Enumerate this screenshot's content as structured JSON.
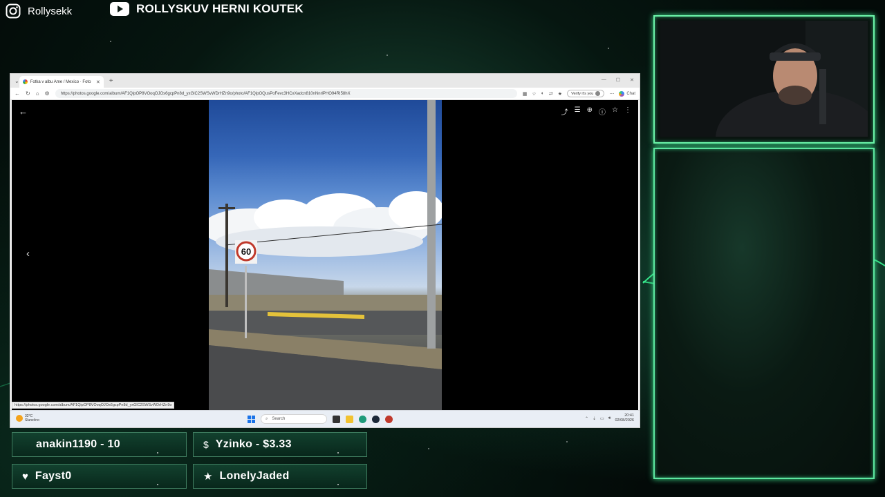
{
  "social": {
    "instagram_handle": "Rollysekk",
    "youtube_channel": "ROLLYSKUV HERNI KOUTEK"
  },
  "browser": {
    "tab_title": "Fotka v albu Ame / Mexico · Foto",
    "new_tab": "+",
    "url": "https://photos.google.com/album/AF1QipOP8VOoqOJOs6gcpPn8d_yxGlC2SWSvWDrHZn9o/photo/AF1QipOQusPoFevc3HCxXadcn810nNnrlPHO94RI58hX",
    "verify_label": "Verify it's you",
    "chat_label": "Chat",
    "status_url": "https://photos.google.com/album/AF1QipOP8VOoqOJOs6gcpPn8d_yxGlC2SWSvWDrHZn9o"
  },
  "taskbar": {
    "weather_temp": "32°C",
    "weather_desc": "Slunečno",
    "search_placeholder": "Search",
    "time": "20:41",
    "date": "02/08/2026"
  },
  "photo": {
    "speed_sign": "60"
  },
  "alerts": {
    "follower": "anakin1190 - 10",
    "donation": "Yzinko - $3.33",
    "sub": "Fayst0",
    "host": "LonelyJaded"
  }
}
